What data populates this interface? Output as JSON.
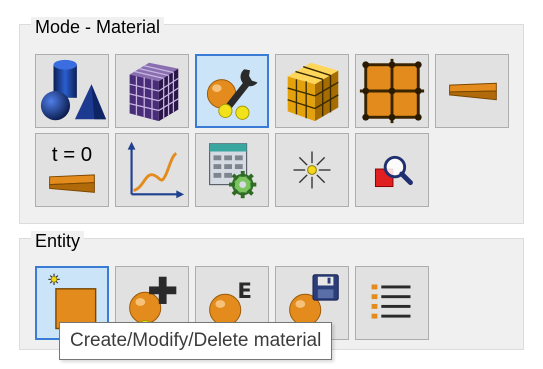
{
  "mode_group": {
    "title": "Mode - Material",
    "buttons": [
      {
        "name": "geometry",
        "icon": "geometry-shapes-icon"
      },
      {
        "name": "mesh",
        "icon": "mesh-cube-icon"
      },
      {
        "name": "material",
        "icon": "material-wrench-icon",
        "selected": true
      },
      {
        "name": "element",
        "icon": "element-cube-icon"
      },
      {
        "name": "nodes",
        "icon": "node-grid-icon"
      },
      {
        "name": "beam",
        "icon": "beam-section-icon"
      },
      {
        "name": "initial-condition",
        "icon": "initial-condition-icon",
        "label": "t = 0"
      },
      {
        "name": "curve",
        "icon": "curve-graph-icon"
      },
      {
        "name": "table",
        "icon": "table-gear-icon"
      },
      {
        "name": "point-load",
        "icon": "starburst-icon"
      },
      {
        "name": "inspect",
        "icon": "magnifier-icon"
      }
    ]
  },
  "entity_group": {
    "title": "Entity",
    "buttons": [
      {
        "name": "create-modify-delete-material",
        "icon": "create-material-icon",
        "selected": true
      },
      {
        "name": "add-material",
        "icon": "add-material-icon"
      },
      {
        "name": "edit-material",
        "icon": "edit-material-icon",
        "letter": "E"
      },
      {
        "name": "save-material",
        "icon": "save-material-icon"
      },
      {
        "name": "material-list",
        "icon": "list-icon"
      }
    ]
  },
  "tooltip": {
    "text": "Create/Modify/Delete material"
  },
  "colors": {
    "panel_bg": "#f0f0f0",
    "button_bg": "#e1e1e1",
    "selected_bg": "#cce4f7",
    "selected_border": "#3a7bd5",
    "orange": "#e38b1c",
    "dark_blue": "#1f3f8f"
  }
}
